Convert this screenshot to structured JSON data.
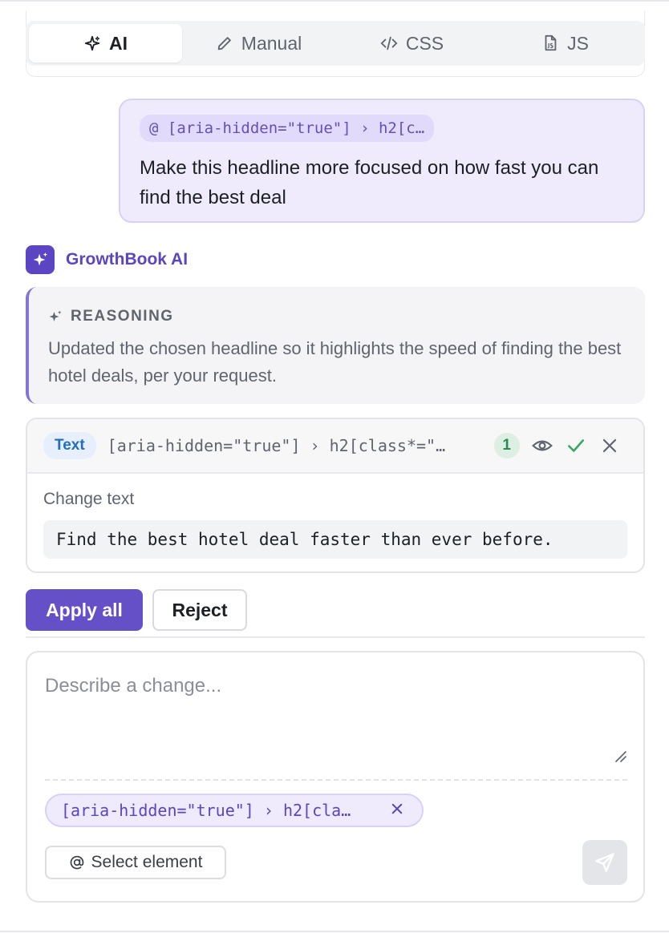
{
  "tabs": [
    {
      "label": "AI",
      "icon": "sparkle-icon",
      "active": true
    },
    {
      "label": "Manual",
      "icon": "pencil-icon",
      "active": false
    },
    {
      "label": "CSS",
      "icon": "code-icon",
      "active": false
    },
    {
      "label": "JS",
      "icon": "js-file-icon",
      "active": false
    }
  ],
  "user_message": {
    "selector": "@ [aria-hidden=\"true\"] › h2[c…",
    "text": "Make this headline more focused on how fast you can find the best deal"
  },
  "assistant": {
    "name": "GrowthBook AI",
    "reasoning_title": "REASONING",
    "reasoning_text": "Updated the chosen headline so it highlights the speed of finding the best hotel deals, per your request."
  },
  "change": {
    "type": "Text",
    "selector": "[aria-hidden=\"true\"] › h2[class*=\"…",
    "count": "1",
    "label": "Change text",
    "value": "Find the best hotel deal faster than ever before."
  },
  "actions": {
    "apply_label": "Apply all",
    "reject_label": "Reject"
  },
  "composer": {
    "placeholder": "Describe a change...",
    "target_selector": "[aria-hidden=\"true\"] › h2[cla…",
    "select_element_label": "Select element"
  },
  "colors": {
    "accent": "#6550c8",
    "accent_light": "#efebfc",
    "success": "#2b8a4e"
  }
}
